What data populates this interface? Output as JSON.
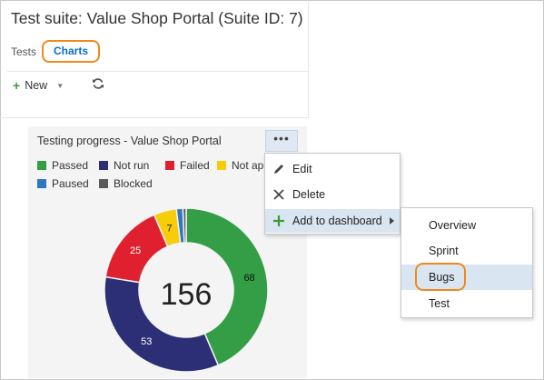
{
  "suite_title": "Test suite: Value Shop Portal (Suite ID: 7)",
  "tabs": [
    {
      "label": "Tests",
      "active": false
    },
    {
      "label": "Charts",
      "active": true
    }
  ],
  "toolbar": {
    "new_label": "New",
    "new_icon": "plus-icon",
    "refresh_icon": "refresh-icon"
  },
  "chart": {
    "title": "Testing progress - Value Shop Portal",
    "more_label": "•••",
    "center_value": "156",
    "legend": [
      {
        "label": "Passed",
        "color": "#339e45"
      },
      {
        "label": "Not run",
        "color": "#2d2f76"
      },
      {
        "label": "Failed",
        "color": "#e0202f"
      },
      {
        "label": "Not ap",
        "color": "#f7cc09"
      },
      {
        "label": "Paused",
        "color": "#2f77bf"
      },
      {
        "label": "Blocked",
        "color": "#5a5a5a"
      }
    ]
  },
  "chart_data": {
    "type": "pie",
    "title": "Testing progress - Value Shop Portal",
    "categories": [
      "Passed",
      "Not run",
      "Failed",
      "Not applicable",
      "Paused",
      "Blocked"
    ],
    "values": [
      68,
      53,
      25,
      7,
      2,
      1
    ],
    "data_labels": [
      "68",
      "53",
      "25",
      "7",
      "",
      ""
    ],
    "colors": [
      "#339e45",
      "#2d2f76",
      "#e0202f",
      "#f7cc09",
      "#2f77bf",
      "#5a5a5a"
    ],
    "total": 156,
    "legend_position": "top"
  },
  "context_menu": {
    "items": [
      {
        "label": "Edit",
        "icon": "pencil-icon"
      },
      {
        "label": "Delete",
        "icon": "close-icon"
      },
      {
        "label": "Add to dashboard",
        "icon": "plus-icon",
        "has_submenu": true
      }
    ]
  },
  "submenu": {
    "items": [
      {
        "label": "Overview"
      },
      {
        "label": "Sprint"
      },
      {
        "label": "Bugs"
      },
      {
        "label": "Test"
      }
    ]
  },
  "colors": {
    "accent": "#0a6ecd",
    "highlight": "#f0891d",
    "selection": "#dae5f2"
  }
}
